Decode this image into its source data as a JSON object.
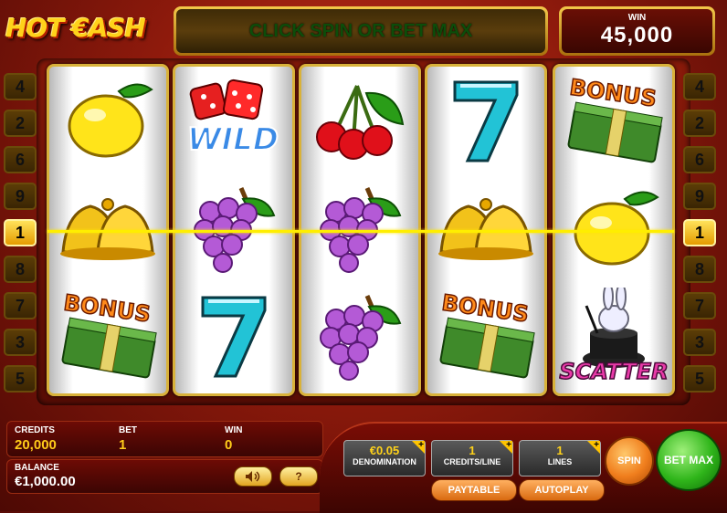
{
  "header": {
    "logo": "HOT €ASH",
    "message": "CLICK SPIN OR BET MAX",
    "win_label": "WIN",
    "win_value": "45,000"
  },
  "paylines_left": [
    "4",
    "2",
    "6",
    "9",
    "1",
    "8",
    "7",
    "3",
    "5"
  ],
  "paylines_right": [
    "4",
    "2",
    "6",
    "9",
    "1",
    "8",
    "7",
    "3",
    "5"
  ],
  "active_payline": "1",
  "reels": [
    [
      "lemon",
      "bell",
      "bonus"
    ],
    [
      "wild",
      "grapes",
      "seven"
    ],
    [
      "cherries",
      "grapes",
      "grapes"
    ],
    [
      "seven",
      "bell",
      "bonus"
    ],
    [
      "bonus",
      "lemon",
      "scatter"
    ]
  ],
  "symbol_text": {
    "wild": "WILD",
    "bonus": "BONUS",
    "scatter": "SCATTER"
  },
  "info": {
    "credits_label": "CREDITS",
    "credits_value": "20,000",
    "bet_label": "BET",
    "bet_value": "1",
    "win_label": "WIN",
    "win_value": "0",
    "balance_label": "BALANCE",
    "balance_value": "€1,000.00",
    "help_label": "?"
  },
  "controls": {
    "denomination_value": "€0.05",
    "denomination_label": "DENOMINATION",
    "credits_line_value": "1",
    "credits_line_label": "CREDITS/LINE",
    "lines_value": "1",
    "lines_label": "LINES",
    "plus_label": "+",
    "paytable_label": "PAYTABLE",
    "autoplay_label": "AUTOPLAY",
    "spin_label": "SPIN",
    "betmax_label": "BET MAX"
  },
  "colors": {
    "payline": "#ffee00",
    "accent_gold": "#ffd21a",
    "spin_orange": "#f07e1d",
    "betmax_green": "#2fb51a"
  }
}
